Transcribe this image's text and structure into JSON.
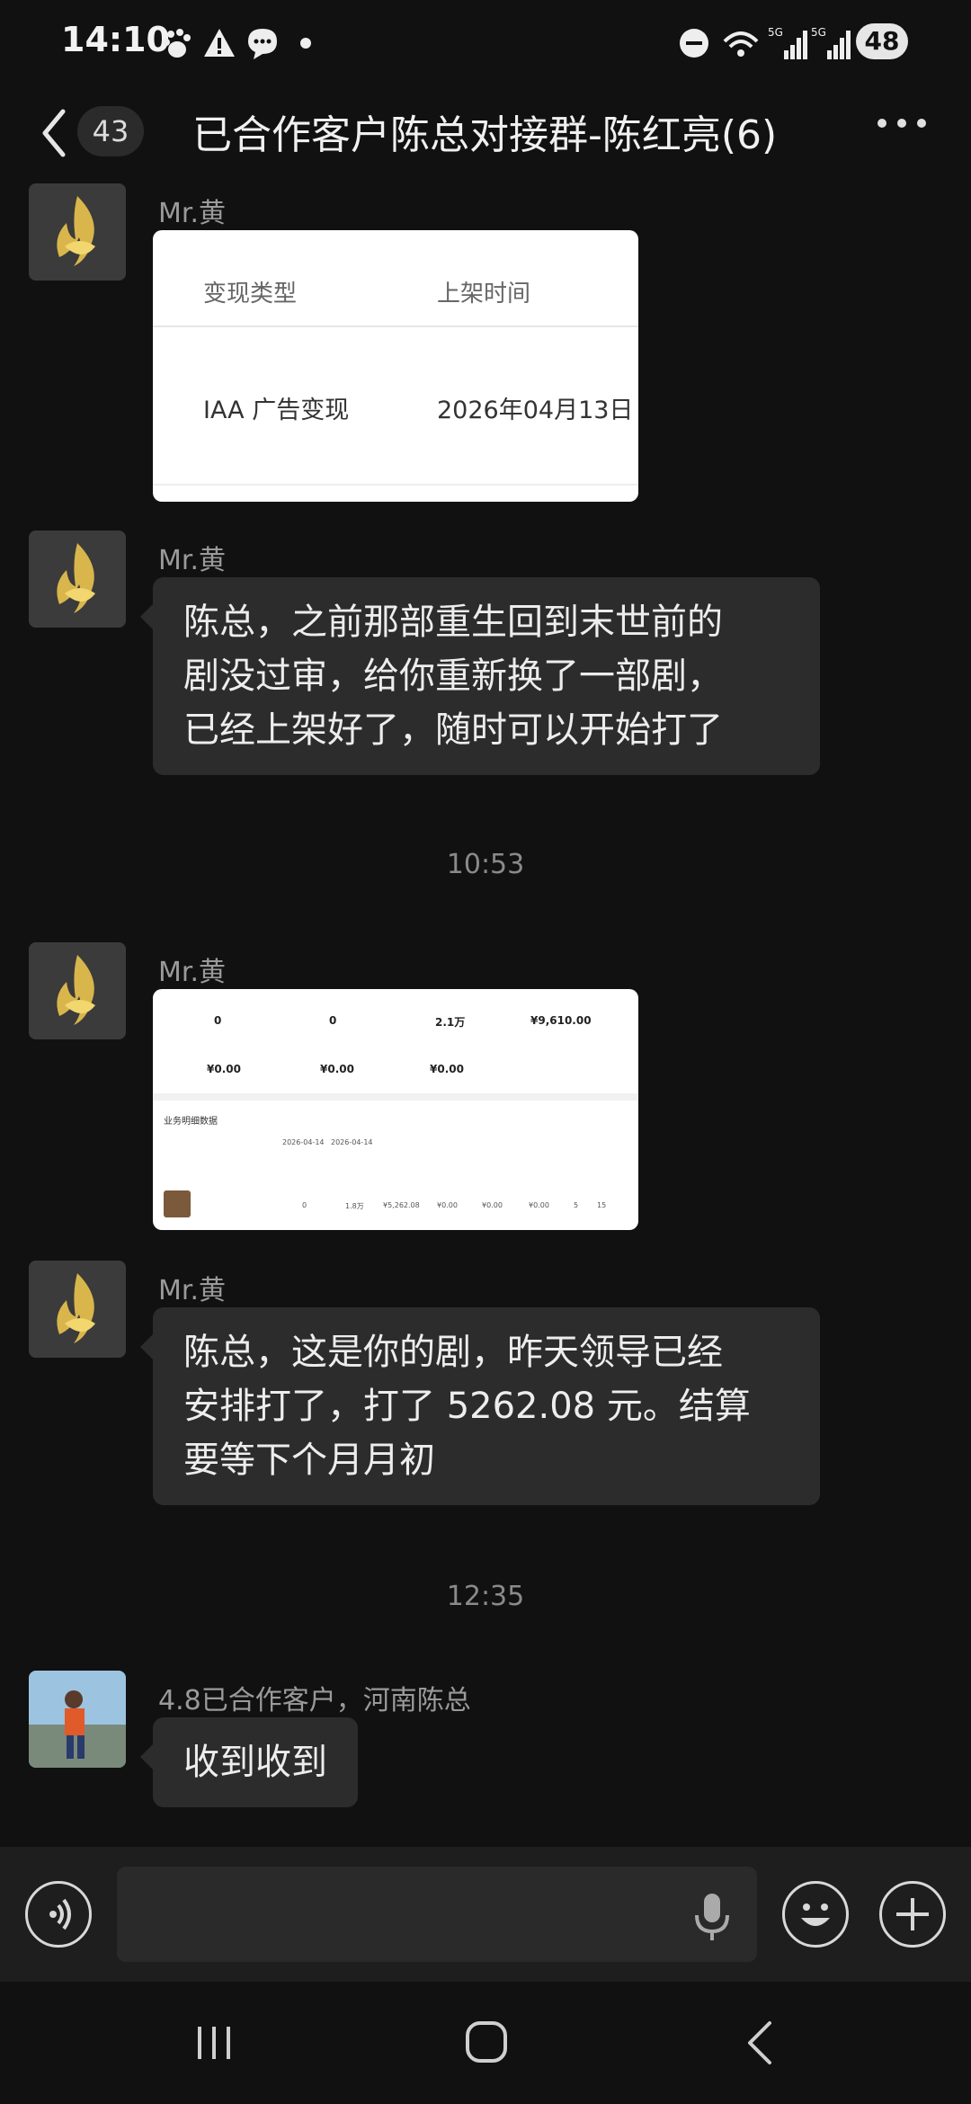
{
  "status_bar": {
    "time": "14:10",
    "battery": "48"
  },
  "header": {
    "unread_count": "43",
    "title": "已合作客户陈总对接群-陈红亮(6)"
  },
  "messages": [
    {
      "sender": "Mr.黄",
      "type": "image",
      "image": {
        "col1_header": "变现类型",
        "col2_header": "上架时间",
        "col1_value": "IAA 广告变现",
        "col2_value": "2026年04月13日"
      }
    },
    {
      "sender": "Mr.黄",
      "type": "text",
      "lines": [
        "陈总，之前那部重生回到末世前的",
        "剧没过审，给你重新换了一部剧，",
        "已经上架好了，随时可以开始打了"
      ]
    },
    {
      "type": "timestamp",
      "time": "10:53"
    },
    {
      "sender": "Mr.黄",
      "type": "image",
      "image": {
        "stat_values": [
          "0",
          "0",
          "2.1万",
          "¥9,610.00",
          "¥0.00",
          "¥0.00",
          "¥0.00"
        ],
        "section_title": "业务明细数据",
        "date_from": "2026-04-14",
        "date_to": "2026-04-14",
        "table_row": [
          "0",
          "1.8万",
          "¥5,262.08",
          "¥0.00",
          "¥0.00",
          "¥0.00",
          "5",
          "15"
        ]
      }
    },
    {
      "sender": "Mr.黄",
      "type": "text",
      "lines": [
        "陈总，这是你的剧，昨天领导已经",
        "安排打了，打了 5262.08 元。结算",
        "要等下个月月初"
      ]
    },
    {
      "type": "timestamp",
      "time": "12:35"
    },
    {
      "sender": "4.8已合作客户，河南陈总",
      "type": "text",
      "lines": [
        "收到收到"
      ]
    }
  ],
  "input": {
    "placeholder": ""
  },
  "colors": {
    "background": "#111111",
    "bubble": "#2c2c2c",
    "text": "#ededed",
    "meta": "#9a9a9a"
  },
  "icons": [
    "back-icon",
    "more-icon",
    "voice-icon",
    "mic-icon",
    "emoji-icon",
    "plus-icon",
    "recents-icon",
    "home-icon",
    "nav-back-icon"
  ]
}
